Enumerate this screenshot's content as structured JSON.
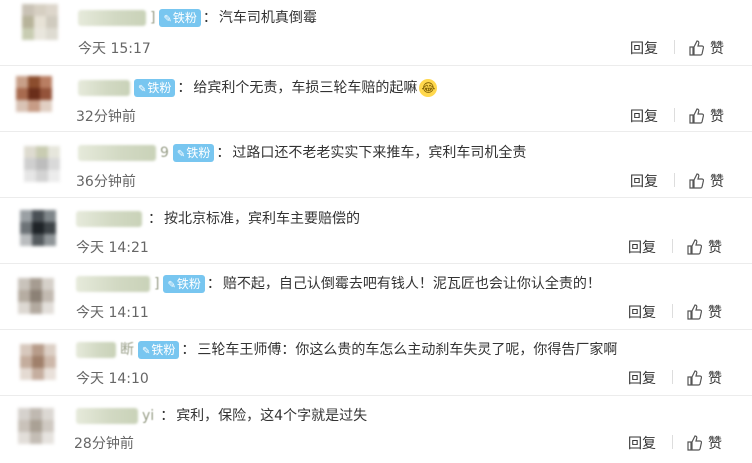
{
  "comments": [
    {
      "badge": "铁粉",
      "text": "汽车司机真倒霉",
      "time": "今天 15:17",
      "reply": "回复",
      "like": "赞"
    },
    {
      "badge": "铁粉",
      "text": "给宾利个无责，车损三轮车赔的起嘛",
      "time": "32分钟前",
      "reply": "回复",
      "like": "赞",
      "nick_tail": ""
    },
    {
      "badge": "铁粉",
      "text": "过路口还不老老实实下来推车，宾利车司机全责",
      "time": "36分钟前",
      "reply": "回复",
      "like": "赞",
      "nick_tail": "9"
    },
    {
      "text": "按北京标准，宾利车主要赔偿的",
      "time": "今天 14:21",
      "reply": "回复",
      "like": "赞"
    },
    {
      "badge": "铁粉",
      "text": "赔不起，自己认倒霉去吧有钱人！泥瓦匠也会让你认全责的！",
      "time": "今天 14:11",
      "reply": "回复",
      "like": "赞",
      "nick_tail": "]"
    },
    {
      "badge": "铁粉",
      "text": "三轮车王师傅：你这么贵的车怎么主动刹车失灵了呢，你得告厂家啊",
      "time": "今天 14:10",
      "reply": "回复",
      "like": "赞",
      "nick_tail": "断"
    },
    {
      "text": "宾利，保险，这4个字就是过失",
      "time": "28分钟前",
      "reply": "回复",
      "like": "赞",
      "nick_tail": "yi"
    }
  ],
  "colors": {
    "badge": "#78c6f0",
    "text": "#333333",
    "time": "#666666"
  },
  "icons": {
    "badge": "fan-badge-icon",
    "like": "thumbs-up-icon",
    "emoji": "laughing-emoji-icon"
  }
}
